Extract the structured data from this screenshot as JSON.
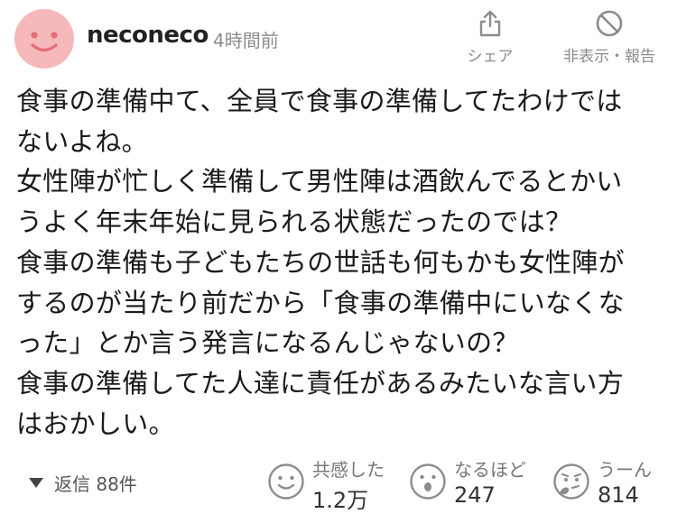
{
  "comment": {
    "username": "neconeco",
    "timestamp": "4時間前",
    "actions": {
      "share_label": "シェア",
      "hide_report_label": "非表示・報告"
    },
    "body_lines": [
      "食事の準備中て、全員で食事の準備してたわけでは",
      "ないよね。",
      "女性陣が忙しく準備して男性陣は酒飲んでるとかい",
      "うよく年末年始に見られる状態だったのでは？",
      "食事の準備も子どもたちの世話も何もかも女性陣が",
      "するのが当たり前だから「食事の準備中にいなくな",
      "った」とか言う発言になるんじゃないの？",
      "食事の準備してた人達に責任があるみたいな言い方",
      "はおかしい。"
    ],
    "replies_label": "返信 88件",
    "reactions": [
      {
        "label": "共感した",
        "count": "1.2万"
      },
      {
        "label": "なるほど",
        "count": "247"
      },
      {
        "label": "うーん",
        "count": "814"
      }
    ],
    "colors": {
      "avatar_bg": "#f6b9bb",
      "muted_text": "#8c8c8c"
    }
  }
}
